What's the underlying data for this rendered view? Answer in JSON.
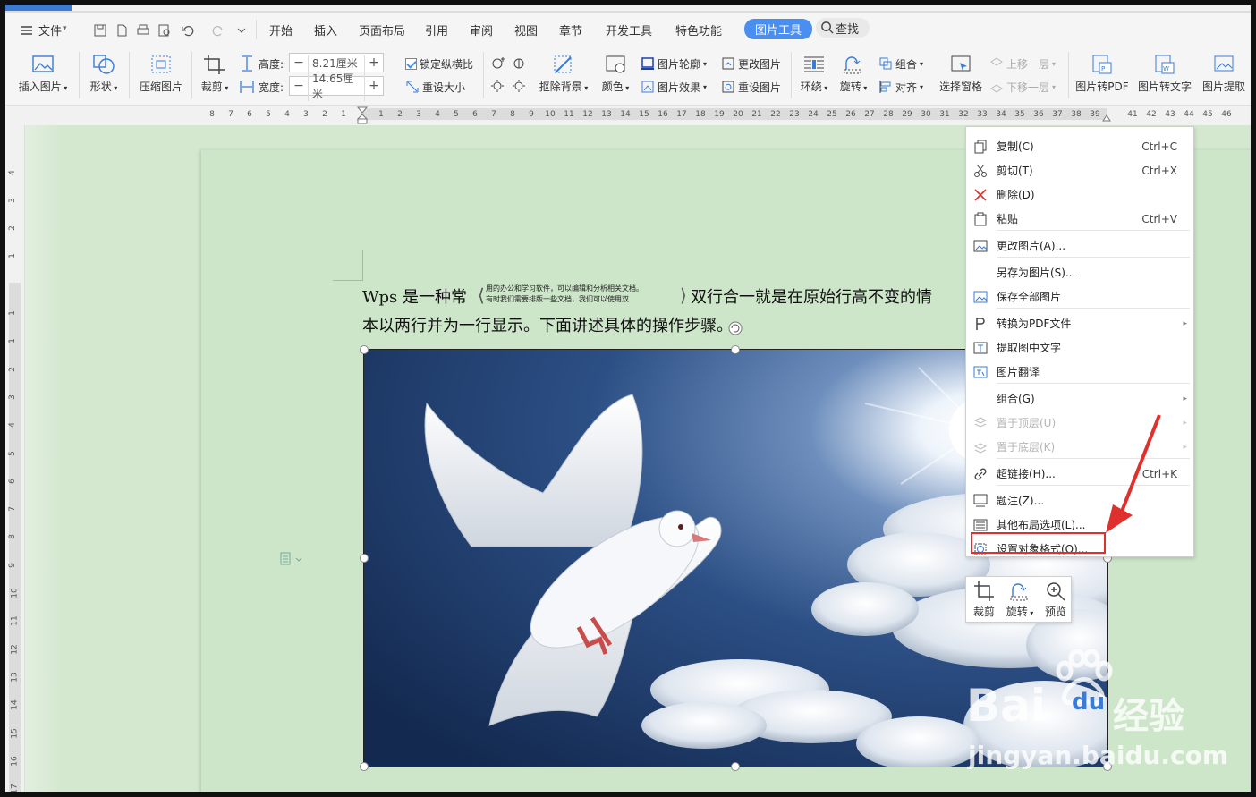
{
  "menubar": {
    "file": "文件",
    "tabs": [
      "开始",
      "插入",
      "页面布局",
      "引用",
      "审阅",
      "视图",
      "章节",
      "开发工具",
      "特色功能"
    ],
    "active_tab": "图片工具",
    "search": "查找"
  },
  "ribbon": {
    "insert_picture": "插入图片",
    "shape": "形状",
    "compress": "压缩图片",
    "crop": "裁剪",
    "height_label": "高度:",
    "height_value": "8.21厘米",
    "width_label": "宽度:",
    "width_value": "14.65厘米",
    "lock_ratio": "锁定纵横比",
    "reset_size": "重设大小",
    "remove_bg": "抠除背景",
    "color": "颜色",
    "outline": "图片轮廓",
    "effects": "图片效果",
    "change_pic": "更改图片",
    "reset_pic": "重设图片",
    "wrap": "环绕",
    "rotate": "旋转",
    "group": "组合",
    "align": "对齐",
    "selection_pane": "选择窗格",
    "bring_forward": "上移一层",
    "send_backward": "下移一层",
    "to_pdf": "图片转PDF",
    "to_text": "图片转文字",
    "extract": "图片提取"
  },
  "ruler": {
    "h_numbers": [
      "8",
      "7",
      "6",
      "5",
      "4",
      "3",
      "2",
      "1",
      "1",
      "2",
      "3",
      "4",
      "5",
      "6",
      "7",
      "8",
      "9",
      "10",
      "11",
      "12",
      "13",
      "14",
      "15",
      "16",
      "17",
      "18",
      "19",
      "20",
      "21",
      "22",
      "23",
      "24",
      "25",
      "26",
      "27",
      "28",
      "29",
      "30",
      "31",
      "32",
      "33",
      "34",
      "35",
      "36",
      "37",
      "38",
      "39",
      "41",
      "42",
      "43",
      "44",
      "45",
      "46"
    ],
    "v_numbers": [
      "4",
      "3",
      "2",
      "1",
      "1",
      "1",
      "2",
      "3",
      "4",
      "5",
      "6",
      "7",
      "8",
      "9",
      "10",
      "11",
      "12",
      "13",
      "14",
      "15",
      "16",
      "17",
      "18"
    ]
  },
  "document": {
    "line1_a": "Wps 是一种常",
    "combined_top": "用的办公和学习软件，可以编辑和分析相关文档。",
    "combined_bottom": "有时我们需要排版一些文档，我们可以使用双",
    "line1_b": "双行合一就是在原始行高不变的情",
    "line2": "本以两行并为一行显示。下面讲述具体的操作步骤。"
  },
  "context_menu": {
    "items": [
      {
        "label": "复制(C)",
        "shortcut": "Ctrl+C",
        "icon": "copy-icon"
      },
      {
        "label": "剪切(T)",
        "shortcut": "Ctrl+X",
        "icon": "cut-icon"
      },
      {
        "label": "删除(D)",
        "shortcut": "",
        "icon": "delete-icon"
      },
      {
        "label": "粘贴",
        "shortcut": "Ctrl+V",
        "icon": "paste-icon"
      },
      {
        "label": "更改图片(A)...",
        "shortcut": "",
        "icon": "change-picture-icon"
      },
      {
        "label": "另存为图片(S)...",
        "shortcut": "",
        "icon": ""
      },
      {
        "label": "保存全部图片",
        "shortcut": "",
        "icon": "save-all-icon"
      },
      {
        "label": "转换为PDF文件",
        "shortcut": "",
        "icon": "pdf-icon"
      },
      {
        "label": "提取图中文字",
        "shortcut": "",
        "icon": "extract-text-icon"
      },
      {
        "label": "图片翻译",
        "shortcut": "",
        "icon": "translate-icon"
      },
      {
        "label": "组合(G)",
        "shortcut": "",
        "icon": ""
      },
      {
        "label": "置于顶层(U)",
        "shortcut": "",
        "icon": "bring-front-icon"
      },
      {
        "label": "置于底层(K)",
        "shortcut": "",
        "icon": "send-back-icon"
      },
      {
        "label": "超链接(H)...",
        "shortcut": "Ctrl+K",
        "icon": "link-icon"
      },
      {
        "label": "题注(Z)...",
        "shortcut": "",
        "icon": "caption-icon"
      },
      {
        "label": "其他布局选项(L)...",
        "shortcut": "",
        "icon": "layout-icon"
      },
      {
        "label": "设置对象格式(O)...",
        "shortcut": "",
        "icon": "format-object-icon"
      }
    ]
  },
  "float_toolbar": {
    "crop": "裁剪",
    "rotate": "旋转",
    "preview": "预览"
  },
  "watermark": {
    "brand_a": "Bai",
    "brand_b": "du",
    "brand_c": "经验",
    "url": "jingyan.baidu.com"
  },
  "colors": {
    "accent": "#4a8ef0",
    "highlight": "#e0302d",
    "page": "#cde6c9"
  }
}
